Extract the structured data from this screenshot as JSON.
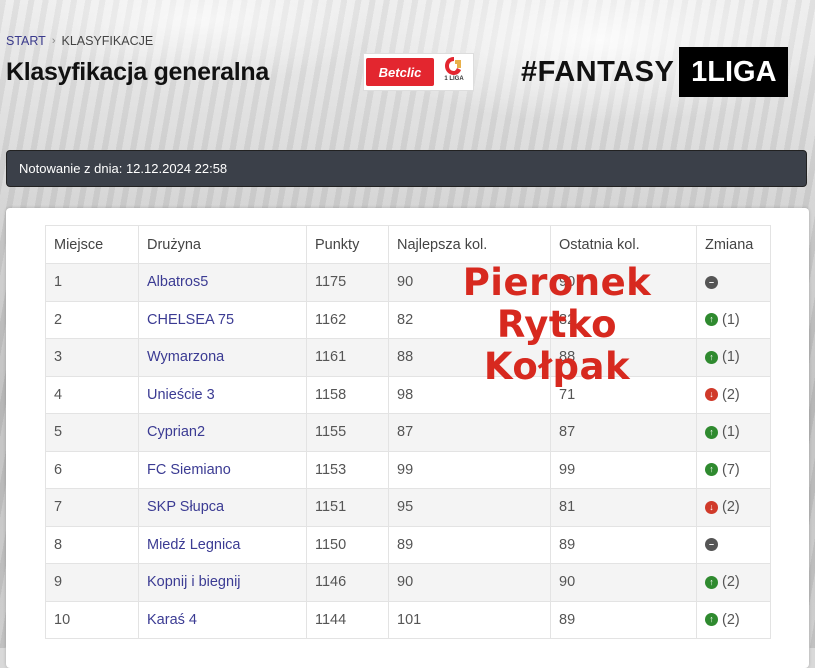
{
  "breadcrumb": {
    "home": "START",
    "current": "KLASYFIKACJE"
  },
  "page_title": "Klasyfikacja generalna",
  "sponsor": {
    "brand": "Betclic",
    "league_badge": "1 LIGA"
  },
  "campaign": {
    "hashtag": "#FANTASY",
    "league": "1LIGA"
  },
  "notice": "Notowanie z dnia: 12.12.2024 22:58",
  "table": {
    "headers": [
      "Miejsce",
      "Drużyna",
      "Punkty",
      "Najlepsza kol.",
      "Ostatnia kol.",
      "Zmiana"
    ],
    "rows": [
      {
        "place": "1",
        "team": "Albatros5",
        "points": "1175",
        "best": "90",
        "last": "90",
        "dir": "same",
        "delta": ""
      },
      {
        "place": "2",
        "team": "CHELSEA 75",
        "points": "1162",
        "best": "82",
        "last": "82",
        "dir": "up",
        "delta": "(1)"
      },
      {
        "place": "3",
        "team": "Wymarzona",
        "points": "1161",
        "best": "88",
        "last": "88",
        "dir": "up",
        "delta": "(1)"
      },
      {
        "place": "4",
        "team": "Unieście 3",
        "points": "1158",
        "best": "98",
        "last": "71",
        "dir": "down",
        "delta": "(2)"
      },
      {
        "place": "5",
        "team": "Cyprian2",
        "points": "1155",
        "best": "87",
        "last": "87",
        "dir": "up",
        "delta": "(1)"
      },
      {
        "place": "6",
        "team": "FC Siemiano",
        "points": "1153",
        "best": "99",
        "last": "99",
        "dir": "up",
        "delta": "(7)"
      },
      {
        "place": "7",
        "team": "SKP Słupca",
        "points": "1151",
        "best": "95",
        "last": "81",
        "dir": "down",
        "delta": "(2)"
      },
      {
        "place": "8",
        "team": "Miedź Legnica",
        "points": "1150",
        "best": "89",
        "last": "89",
        "dir": "same",
        "delta": ""
      },
      {
        "place": "9",
        "team": "Kopnij i biegnij",
        "points": "1146",
        "best": "90",
        "last": "90",
        "dir": "up",
        "delta": "(2)"
      },
      {
        "place": "10",
        "team": "Karaś 4",
        "points": "1144",
        "best": "101",
        "last": "89",
        "dir": "up",
        "delta": "(2)"
      }
    ]
  },
  "overlay_names": [
    "Pieronek",
    "Rytko",
    "Kołpak"
  ],
  "colors": {
    "link": "#3b3b93",
    "up": "#2f8a2f",
    "down": "#d03a2a",
    "same": "#555555",
    "overlay": "#d7291f",
    "betclic": "#e3262f"
  }
}
